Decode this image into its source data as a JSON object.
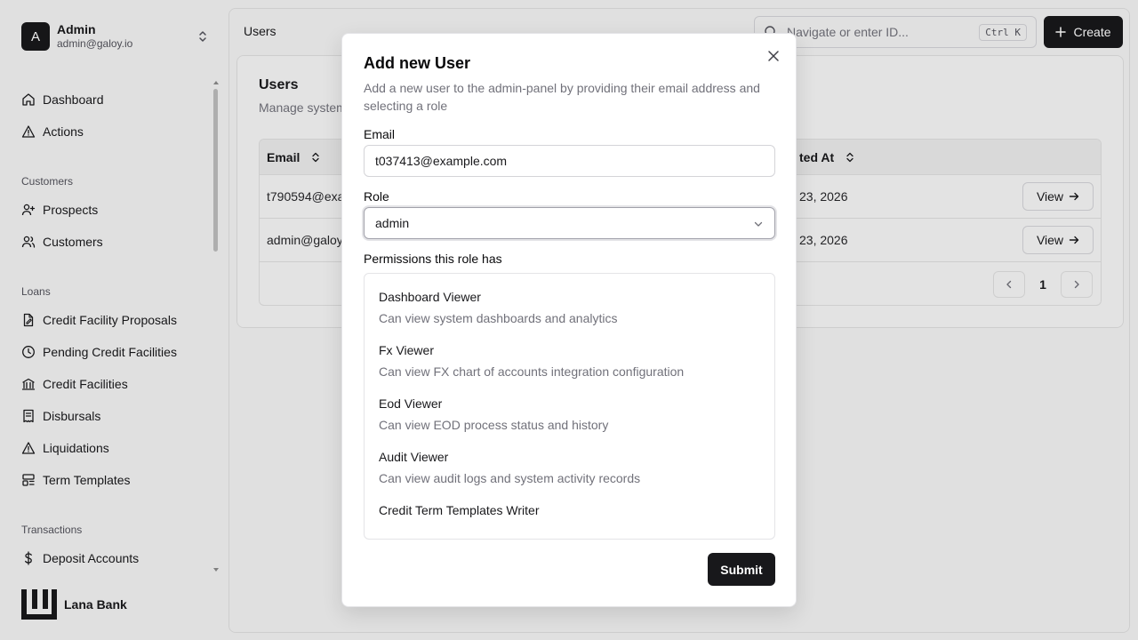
{
  "account": {
    "initial": "A",
    "name": "Admin",
    "email": "admin@galoy.io"
  },
  "nav": {
    "dashboard": "Dashboard",
    "actions": "Actions",
    "group_customers": "Customers",
    "prospects": "Prospects",
    "customers": "Customers",
    "group_loans": "Loans",
    "credit_facility_proposals": "Credit Facility Proposals",
    "pending_credit_facilities": "Pending Credit Facilities",
    "credit_facilities": "Credit Facilities",
    "disbursals": "Disbursals",
    "liquidations": "Liquidations",
    "term_templates": "Term Templates",
    "group_transactions": "Transactions",
    "deposit_accounts": "Deposit Accounts"
  },
  "brand": {
    "name": "Lana Bank"
  },
  "header": {
    "breadcrumb": "Users",
    "search_placeholder": "Navigate or enter ID...",
    "shortcut": "Ctrl K",
    "create_label": "Create"
  },
  "users_card": {
    "title": "Users",
    "subtitle": "Manage system",
    "columns": {
      "email": "Email",
      "created_at": "ted At"
    },
    "rows": [
      {
        "email": "t790594@exa",
        "created": "23, 2026",
        "action": "View"
      },
      {
        "email": "admin@galoy.",
        "created": "23, 2026",
        "action": "View"
      }
    ],
    "page": "1"
  },
  "modal": {
    "title": "Add new User",
    "description": "Add a new user to the admin-panel by providing their email address and selecting a role",
    "email_label": "Email",
    "email_value": "t037413@example.com",
    "role_label": "Role",
    "role_value": "admin",
    "permissions_label": "Permissions this role has",
    "permissions": [
      {
        "name": "Dashboard Viewer",
        "desc": "Can view system dashboards and analytics"
      },
      {
        "name": "Fx Viewer",
        "desc": "Can view FX chart of accounts integration configuration"
      },
      {
        "name": "Eod Viewer",
        "desc": "Can view EOD process status and history"
      },
      {
        "name": "Audit Viewer",
        "desc": "Can view audit logs and system activity records"
      },
      {
        "name": "Credit Term Templates Writer",
        "desc": ""
      }
    ],
    "submit_label": "Submit"
  }
}
